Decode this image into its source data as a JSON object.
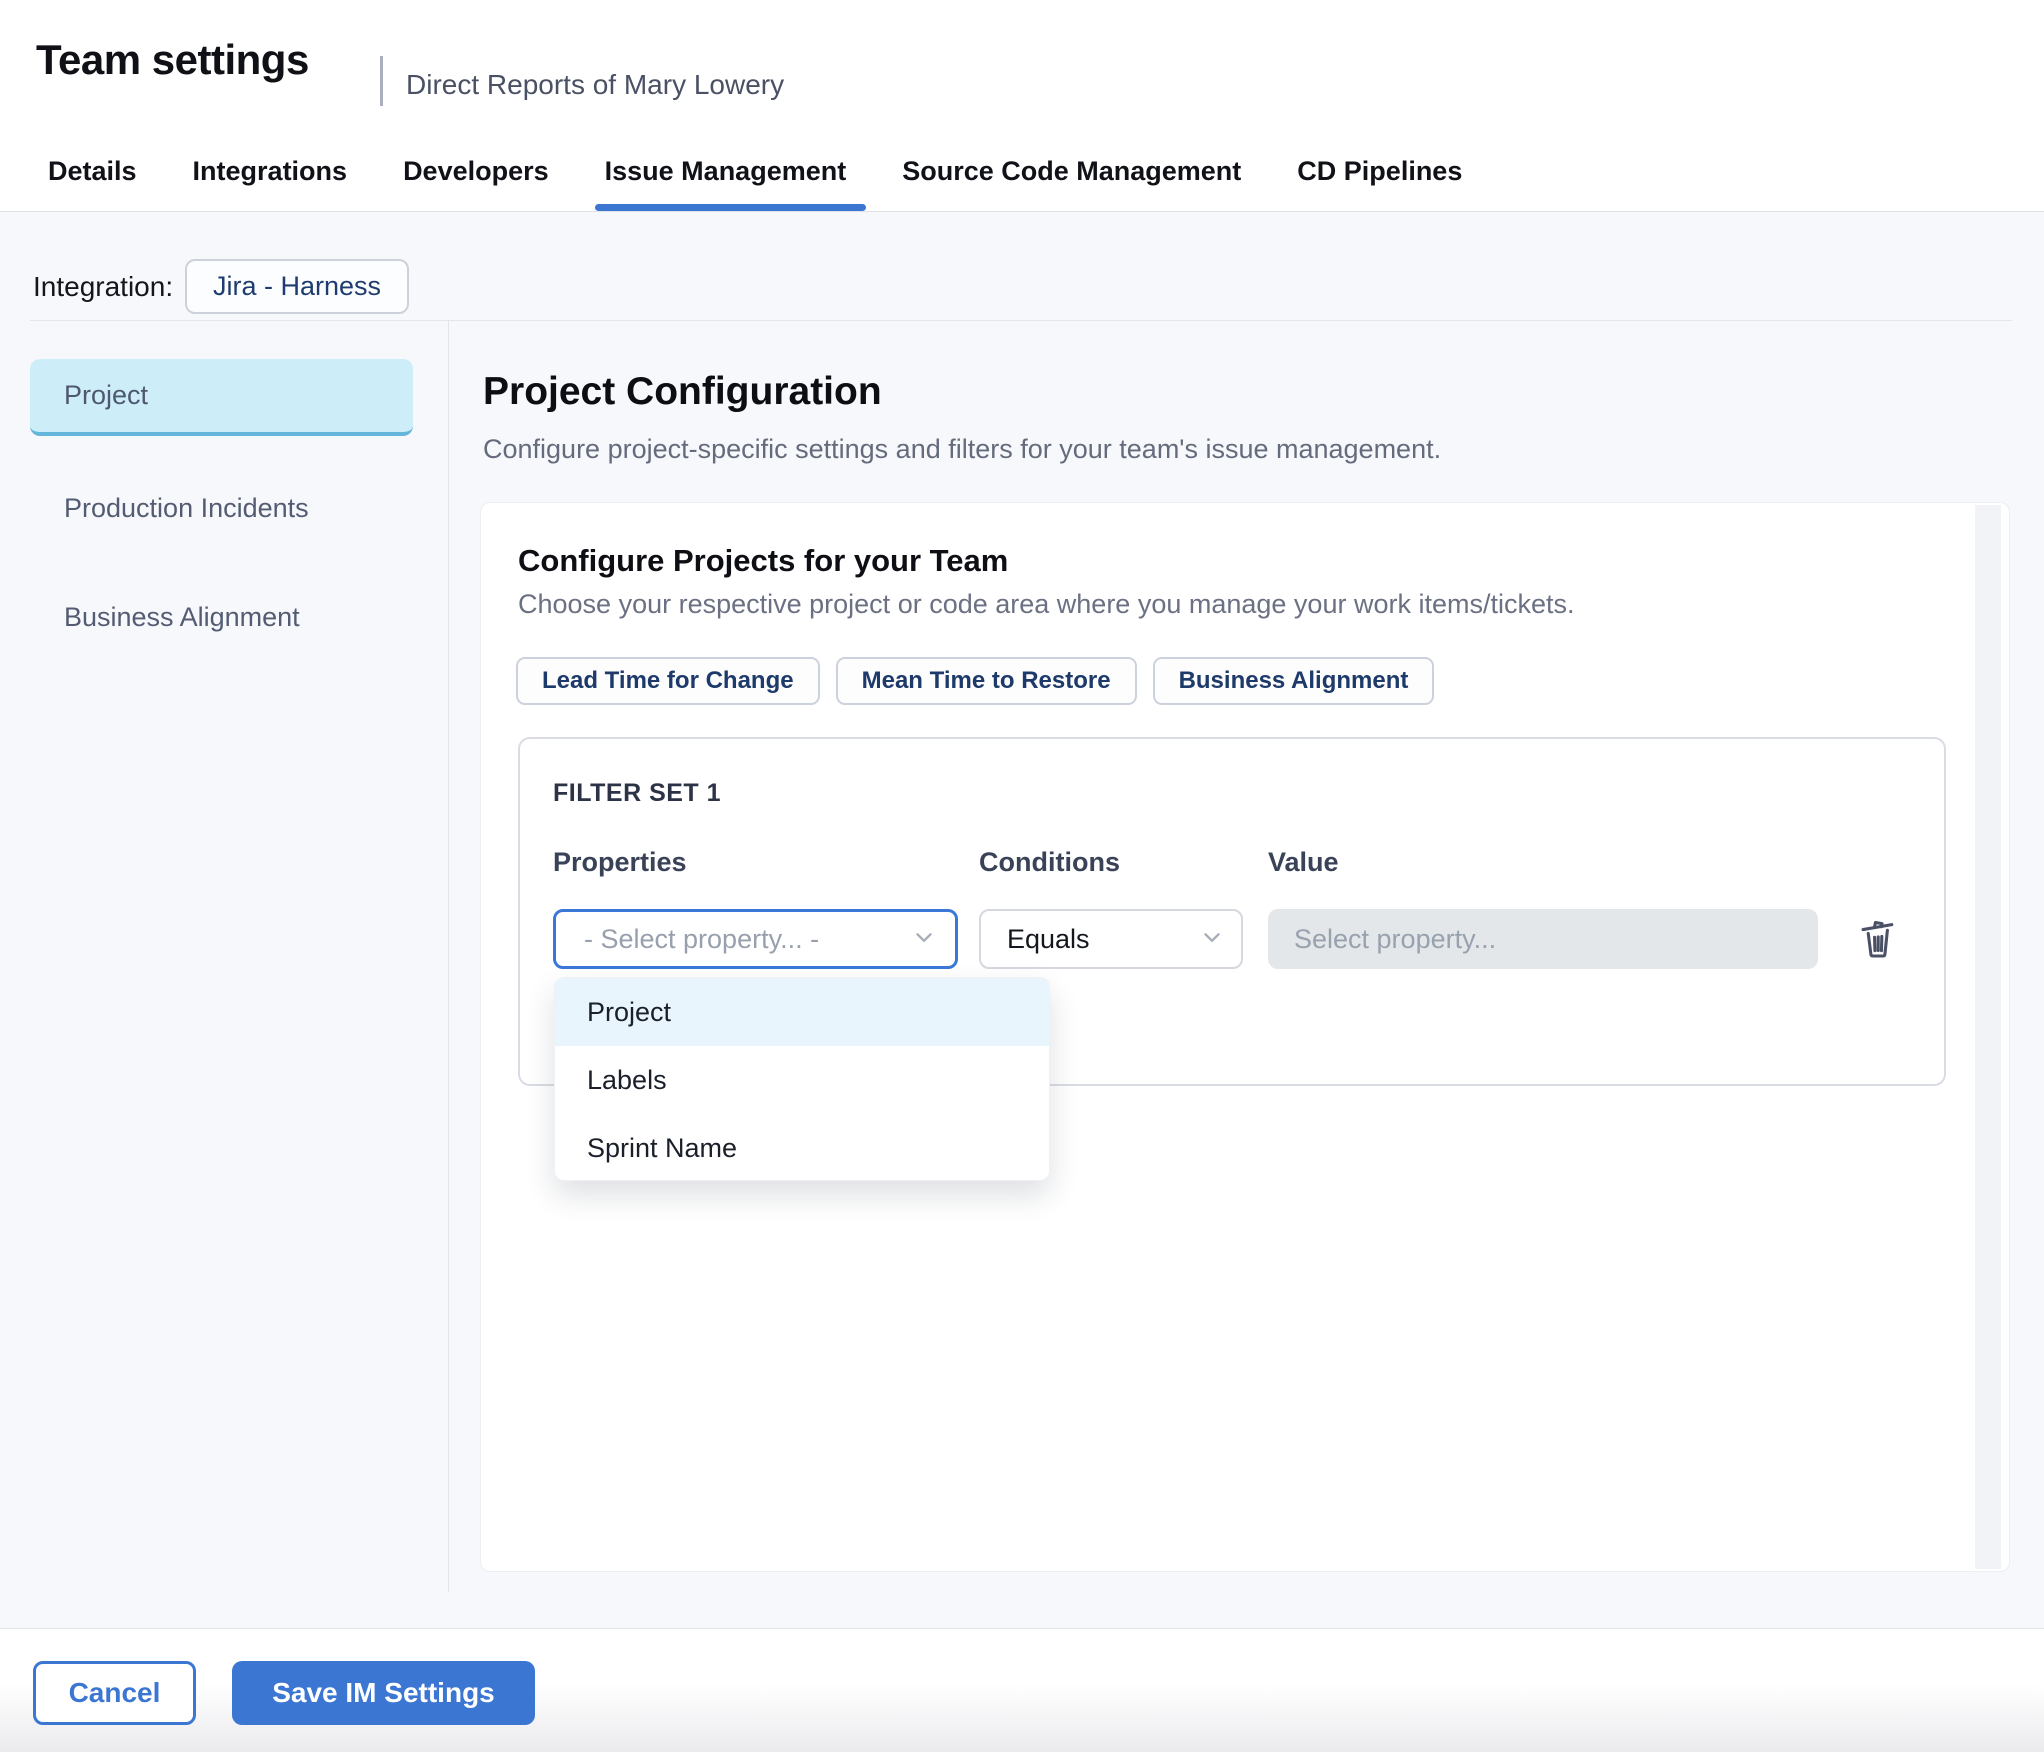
{
  "header": {
    "title": "Team settings",
    "subtitle": "Direct Reports of Mary Lowery"
  },
  "tabs": [
    {
      "label": "Details"
    },
    {
      "label": "Integrations"
    },
    {
      "label": "Developers"
    },
    {
      "label": "Issue Management"
    },
    {
      "label": "Source Code Management"
    },
    {
      "label": "CD Pipelines"
    }
  ],
  "active_tab": "Issue Management",
  "integration": {
    "label": "Integration:",
    "value": "Jira - Harness"
  },
  "sidebar": {
    "items": [
      {
        "label": "Project",
        "selected": true
      },
      {
        "label": "Production Incidents",
        "selected": false
      },
      {
        "label": "Business Alignment",
        "selected": false
      }
    ]
  },
  "main": {
    "title": "Project Configuration",
    "description": "Configure project-specific settings and filters for your team's issue management.",
    "card": {
      "title": "Configure Projects for your Team",
      "description": "Choose your respective project or code area where you manage your work items/tickets.",
      "metric_tabs": [
        {
          "label": "Lead Time for Change"
        },
        {
          "label": "Mean Time to Restore"
        },
        {
          "label": "Business Alignment"
        }
      ],
      "filter_set": {
        "title": "FILTER SET 1",
        "columns": [
          {
            "label": "Properties"
          },
          {
            "label": "Conditions"
          },
          {
            "label": "Value"
          }
        ],
        "property_select": {
          "value": "- Select property... -"
        },
        "condition_select": {
          "value": "Equals"
        },
        "value_input": {
          "placeholder": "Select property..."
        },
        "dropdown": {
          "options": [
            {
              "label": "Project",
              "highlighted": true
            },
            {
              "label": "Labels",
              "highlighted": false
            },
            {
              "label": "Sprint Name",
              "highlighted": false
            }
          ]
        }
      }
    }
  },
  "footer": {
    "cancel_label": "Cancel",
    "save_label": "Save IM Settings"
  },
  "colors": {
    "accent_blue": "#3b76d3",
    "tab_underline": "#3575d4",
    "selected_sidebar_bg": "#cdeef9",
    "selected_sidebar_border": "#64b7da",
    "dropdown_highlight": "#e9f5fc",
    "chip_text": "#1d3a6a",
    "content_bg": "#f7f8fb",
    "value_input_bg": "#e4e7e9"
  }
}
